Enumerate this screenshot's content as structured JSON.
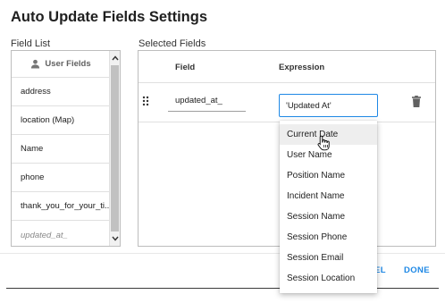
{
  "dialog": {
    "title": "Auto Update Fields Settings",
    "field_list_label": "Field List",
    "selected_fields_label": "Selected Fields"
  },
  "field_list": {
    "header": "User Fields",
    "header_icon": "person-icon",
    "items": [
      "address",
      "location (Map)",
      "Name",
      "phone",
      "thank_you_for_your_ti...",
      "updated_at_"
    ]
  },
  "selected_fields": {
    "col_field": "Field",
    "col_expression": "Expression",
    "rows": [
      {
        "field": "updated_at_",
        "expression": "'Updated At'"
      }
    ]
  },
  "dropdown": {
    "options": [
      "Current Date",
      "User Name",
      "Position Name",
      "Incident Name",
      "Session Name",
      "Session Phone",
      "Session Email",
      "Session Location"
    ],
    "hovered": "Current Date"
  },
  "footer": {
    "cancel_label": "CANCEL",
    "done_label": "DONE"
  },
  "colors": {
    "accent": "#1e88e5",
    "hover": "#eeeeee",
    "border": "#bdbdbd"
  }
}
